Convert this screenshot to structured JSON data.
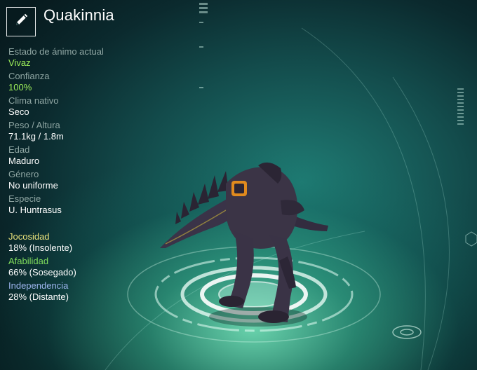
{
  "creature": {
    "name": "Quakinnia"
  },
  "stats": [
    {
      "label": "Estado de ánimo actual",
      "value": "Vivaz",
      "value_color": "#9ef05a"
    },
    {
      "label": "Confianza",
      "value": "100%",
      "value_color": "#9ef05a"
    },
    {
      "label": "Clima nativo",
      "value": "Seco"
    },
    {
      "label": "Peso / Altura",
      "value": "71.1kg / 1.8m"
    },
    {
      "label": "Edad",
      "value": "Maduro"
    },
    {
      "label": "Género",
      "value": "No uniforme"
    },
    {
      "label": "Especie",
      "value": "U. Huntrasus"
    }
  ],
  "traits": [
    {
      "label": "Jocosidad",
      "value": "18% (Insolente)",
      "label_color": "#e8e07a"
    },
    {
      "label": "Afabilidad",
      "value": "66% (Sosegado)",
      "label_color": "#7fdc5c"
    },
    {
      "label": "Independencia",
      "value": "28% (Distante)",
      "label_color": "#9fb6f0"
    }
  ],
  "icons": {
    "edit": "pencil-icon"
  }
}
